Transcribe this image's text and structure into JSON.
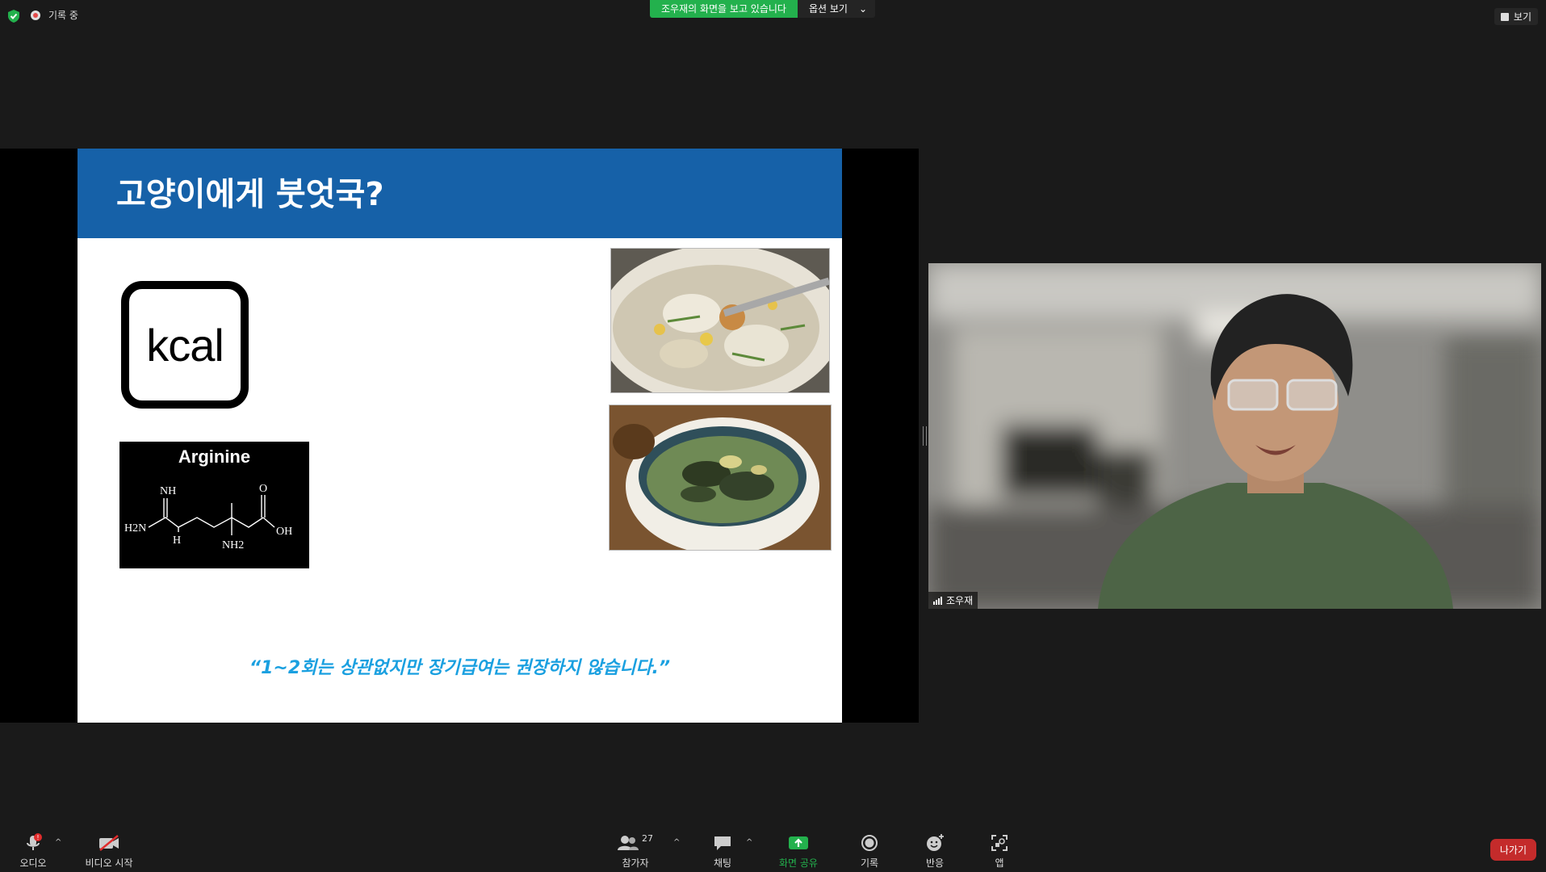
{
  "topbar": {
    "recording": "기록 중",
    "sharing_banner": "조우재의 화면을 보고 있습니다",
    "view_options": "옵션 보기",
    "view": "보기"
  },
  "slide": {
    "title": "고양이에게 붓엇국?",
    "kcal": "kcal",
    "arginine": "Arginine",
    "chem": {
      "nh": "NH",
      "h2n": "H2N",
      "h": "H",
      "o": "O",
      "oh": "OH",
      "nh2": "NH2"
    },
    "quote": "“1~2회는 상관없지만 장기급여는 권장하지 않습니다.”"
  },
  "video": {
    "participant_name": "조우재"
  },
  "toolbar": {
    "audio": "오디오",
    "video_start": "비디오 시작",
    "participants": "참가자",
    "participant_count": "27",
    "chat": "채팅",
    "share_screen": "화면 공유",
    "record": "기록",
    "reactions": "반응",
    "apps": "앱",
    "leave": "나가기",
    "audio_alert": "!"
  },
  "colors": {
    "slide_header": "#1661a8",
    "share_green": "#23b14d",
    "leave_red": "#c42b2b",
    "quote_blue": "#1aa0e0"
  }
}
